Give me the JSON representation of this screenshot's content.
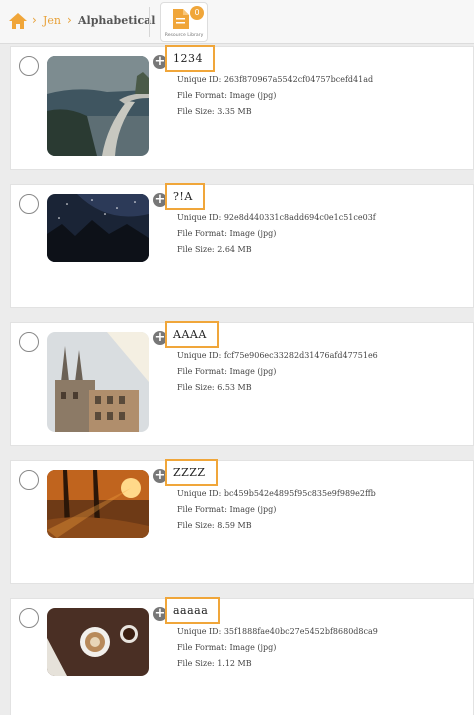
{
  "breadcrumb": {
    "parent": "Jen",
    "current": "Alphabetical"
  },
  "resource_library": {
    "label": "Resource Library",
    "count": "0",
    "accent": "#f0a63a"
  },
  "labels": {
    "unique_id": "Unique ID:",
    "file_format": "File Format:",
    "file_size": "File Size:"
  },
  "items": [
    {
      "title": "1234",
      "unique_id": "263f870967a5542cf04757bcefd41ad",
      "file_format": "Image (jpg)",
      "file_size": "3.35 MB",
      "thumbnail": "coastal-highway-photo"
    },
    {
      "title": "?!A",
      "unique_id": "92e8d440331c8add694c0e1c51ce03f",
      "file_format": "Image (jpg)",
      "file_size": "2.64 MB",
      "thumbnail": "night-sky-mountains-photo"
    },
    {
      "title": "AAAA",
      "unique_id": "fcf75e906ec33282d31476afd47751e6",
      "file_format": "Image (jpg)",
      "file_size": "6.53 MB",
      "thumbnail": "church-spires-city-photo"
    },
    {
      "title": "ZZZZ",
      "unique_id": "bc459b542e4895f95c835e9f989e2ffb",
      "file_format": "Image (jpg)",
      "file_size": "8.59 MB",
      "thumbnail": "autumn-forest-sunburst-photo"
    },
    {
      "title": "aaaaa",
      "unique_id": "35f1888fae40bc27e5452bf8680d8ca9",
      "file_format": "Image (jpg)",
      "file_size": "1.12 MB",
      "thumbnail": "coffee-cups-table-photo"
    }
  ]
}
